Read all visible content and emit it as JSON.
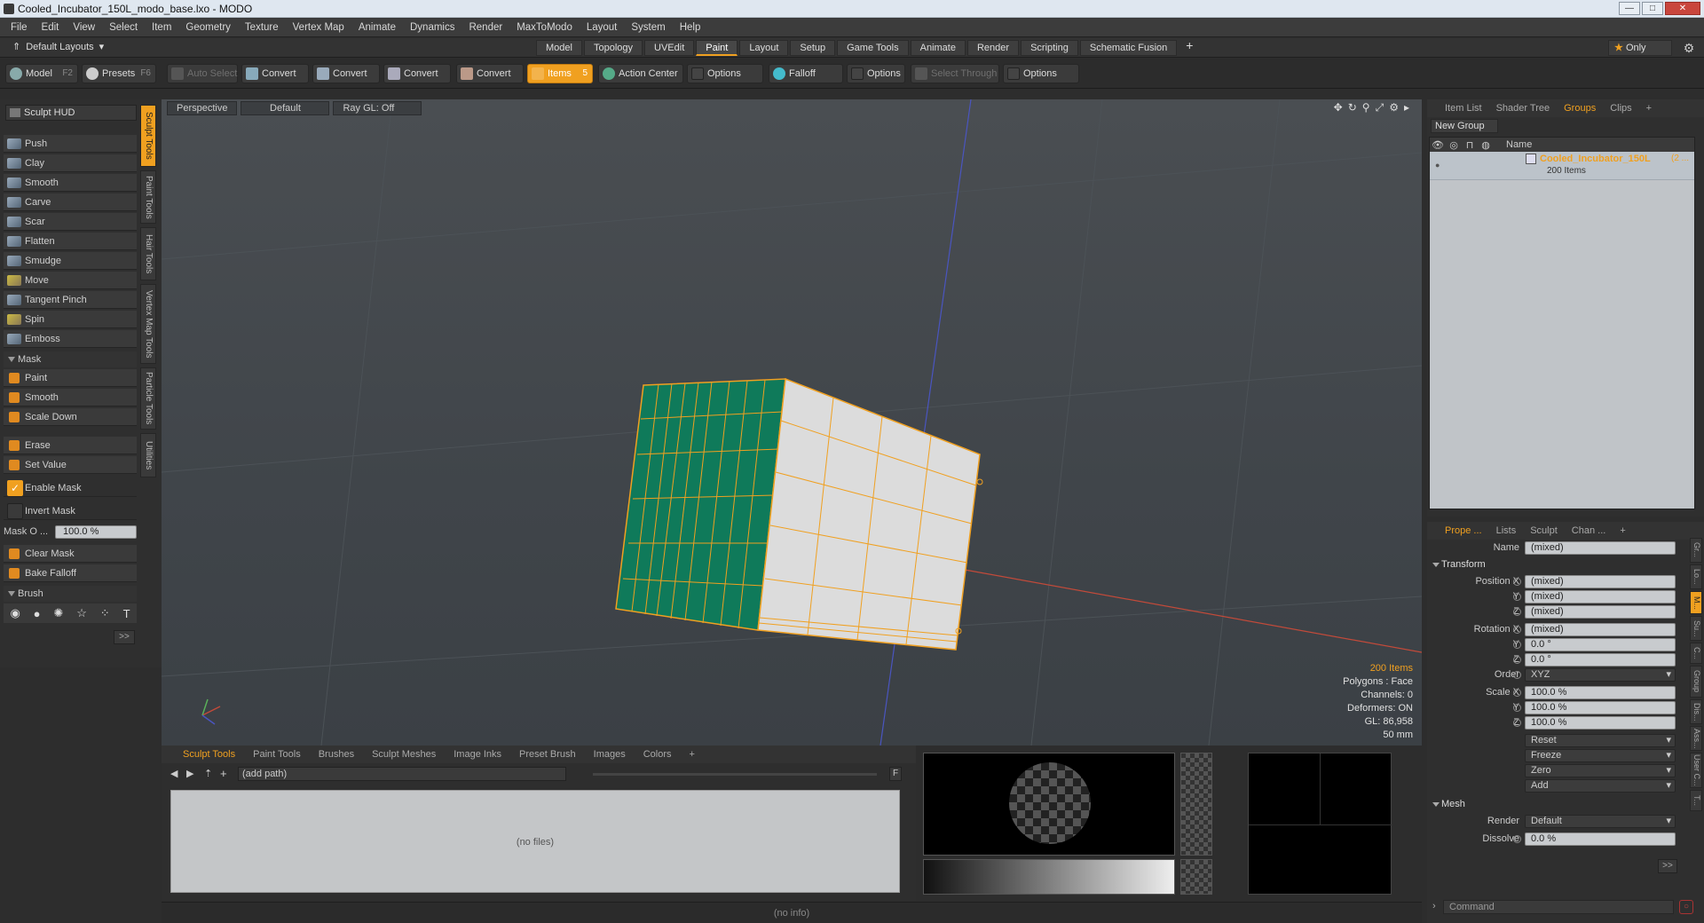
{
  "window": {
    "title": "Cooled_Incubator_150L_modo_base.lxo - MODO",
    "buttons": {
      "minimize": "—",
      "maximize": "□",
      "close": "✕"
    }
  },
  "menu": [
    "File",
    "Edit",
    "View",
    "Select",
    "Item",
    "Geometry",
    "Texture",
    "Vertex Map",
    "Animate",
    "Dynamics",
    "Render",
    "MaxToModo",
    "Layout",
    "System",
    "Help"
  ],
  "layouts": {
    "selector": "Default Layouts",
    "tabs": [
      "Model",
      "Topology",
      "UVEdit",
      "Paint",
      "Layout",
      "Setup",
      "Game Tools",
      "Animate",
      "Render",
      "Scripting",
      "Schematic Fusion"
    ],
    "active_tab": "Paint",
    "only_label": "Only"
  },
  "toolbar": {
    "model": "Model",
    "model_key": "F2",
    "presets": "Presets",
    "presets_key": "F6",
    "auto_select": "Auto Select",
    "convert1": "Convert",
    "convert2": "Convert",
    "convert3": "Convert",
    "convert4": "Convert",
    "items": "Items",
    "items_key": "5",
    "action_center": "Action Center",
    "options1": "Options",
    "falloff": "Falloff",
    "options2": "Options",
    "select_through": "Select Through",
    "options3": "Options"
  },
  "left_panel": {
    "hud": "Sculpt HUD",
    "tools": [
      "Push",
      "Clay",
      "Smooth",
      "Carve",
      "Scar",
      "Flatten",
      "Smudge",
      "Move",
      "Tangent Pinch",
      "Spin",
      "Emboss"
    ],
    "mask_section": "Mask",
    "mask_tools": [
      "Paint",
      "Smooth",
      "Scale Down"
    ],
    "erase": "Erase",
    "set_value": "Set Value",
    "enable_mask": "Enable Mask",
    "invert_mask": "Invert Mask",
    "mask_opacity_label": "Mask O ...",
    "mask_opacity_value": "100.0 %",
    "clear_mask": "Clear Mask",
    "bake_falloff": "Bake Falloff",
    "brush_section": "Brush",
    "more": ">>",
    "vertical_tabs": [
      "Sculpt Tools",
      "Paint Tools",
      "Hair Tools",
      "Vertex Map Tools",
      "Particle Tools",
      "Utilities"
    ]
  },
  "viewport": {
    "view": "Perspective",
    "shading": "Default",
    "raygl": "Ray GL: Off",
    "stats": {
      "items": "200 Items",
      "polygons": "Polygons : Face",
      "channels": "Channels: 0",
      "deformers": "Deformers: ON",
      "gl": "GL: 86,958",
      "focal": "50 mm"
    }
  },
  "bottom_panel": {
    "tabs": [
      "Sculpt Tools",
      "Paint Tools",
      "Brushes",
      "Sculpt Meshes",
      "Image Inks",
      "Preset Brush",
      "Images",
      "Colors"
    ],
    "active_tab": "Sculpt Tools",
    "path": "(add path)",
    "no_files": "(no files)",
    "f_label": "F"
  },
  "status": {
    "info": "(no info)"
  },
  "right_top": {
    "tabs": [
      "Item List",
      "Shader Tree",
      "Groups",
      "Clips"
    ],
    "active_tab": "Groups",
    "new_group": "New Group",
    "name_col": "Name",
    "group_name": "Cooled_Incubator_150L",
    "group_suffix": "(2 ...",
    "group_count": "200 Items"
  },
  "properties": {
    "tabs": [
      "Prope ...",
      "Lists",
      "Sculpt",
      "Chan ..."
    ],
    "active_tab": "Prope ...",
    "name_label": "Name",
    "name_value": "(mixed)",
    "transform": "Transform",
    "position_x_label": "Position X",
    "position_x": "(mixed)",
    "position_y_label": "Y",
    "position_y": "(mixed)",
    "position_z_label": "Z",
    "position_z": "(mixed)",
    "rotation_x_label": "Rotation X",
    "rotation_x": "(mixed)",
    "rotation_y_label": "Y",
    "rotation_y": "0.0 °",
    "rotation_z_label": "Z",
    "rotation_z": "0.0 °",
    "order_label": "Order",
    "order": "XYZ",
    "scale_x_label": "Scale X",
    "scale_x": "100.0 %",
    "scale_y_label": "Y",
    "scale_y": "100.0 %",
    "scale_z_label": "Z",
    "scale_z": "100.0 %",
    "reset": "Reset",
    "freeze": "Freeze",
    "zero": "Zero",
    "add": "Add",
    "mesh": "Mesh",
    "render_label": "Render",
    "render": "Default",
    "dissolve_label": "Dissolve",
    "dissolve": "0.0 %",
    "more": ">>",
    "command_placeholder": "Command",
    "vertical_tabs": [
      "Gr...",
      "Lo...",
      "M...",
      "Su...",
      "C...",
      "Group",
      "Dis...",
      "Ass...",
      "User C...",
      "T..."
    ]
  },
  "colors": {
    "accent": "#f0a020",
    "mesh_green": "#0f7a5a",
    "mesh_face": "#dcdcdc"
  }
}
